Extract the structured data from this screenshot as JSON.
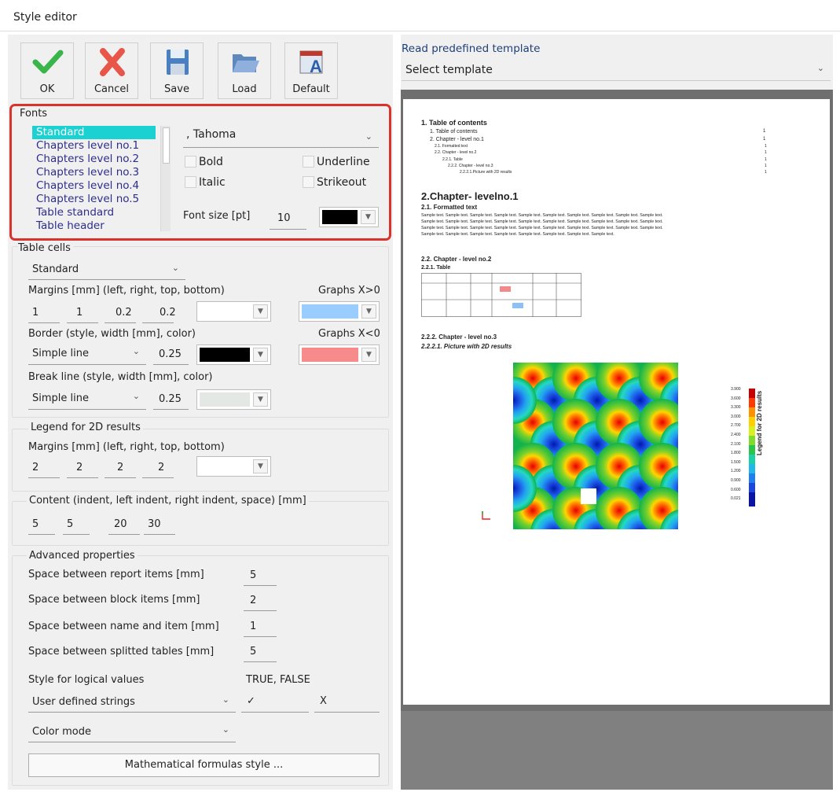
{
  "window": {
    "title": "Style editor"
  },
  "toolbar": {
    "ok": "OK",
    "cancel": "Cancel",
    "save": "Save",
    "load": "Load",
    "default": "Default"
  },
  "fonts": {
    "title": "Fonts",
    "items": [
      "Standard",
      "Chapters level no.1",
      "Chapters level no.2",
      "Chapters level no.3",
      "Chapters level no.4",
      "Chapters level no.5",
      "Table standard",
      "Table header"
    ],
    "font_name": ", Tahoma",
    "bold": "Bold",
    "underline": "Underline",
    "italic": "Italic",
    "strikeout": "Strikeout",
    "size_label": "Font size [pt]",
    "size_value": "10",
    "color": "#000000"
  },
  "table_cells": {
    "title": "Table cells",
    "style_select": "Standard",
    "margins_label": "Margins [mm] (left, right, top, bottom)",
    "margins": [
      "1",
      "1",
      "0.2",
      "0.2"
    ],
    "margins_color": "#ffffff",
    "graphs_pos_label": "Graphs X>0",
    "graphs_pos_color": "#99ccff",
    "border_label": "Border (style, width [mm], color)",
    "border_style": "Simple line",
    "border_width": "0.25",
    "border_color": "#000000",
    "graphs_neg_label": "Graphs X<0",
    "graphs_neg_color": "#f78a8a",
    "break_label": "Break line (style, width [mm], color)",
    "break_style": "Simple line",
    "break_width": "0.25",
    "break_color": "#e4e8e4"
  },
  "legend2d": {
    "title": "Legend for 2D results",
    "margins_label": "Margins [mm] (left, right, top, bottom)",
    "margins": [
      "2",
      "2",
      "2",
      "2"
    ],
    "color": "#ffffff"
  },
  "content": {
    "title": "Content (indent, left indent, right indent, space) [mm]",
    "values": [
      "5",
      "5",
      "20",
      "30"
    ]
  },
  "advanced": {
    "title": "Advanced properties",
    "rows": [
      {
        "label": "Space between report items [mm]",
        "value": "5"
      },
      {
        "label": "Space between block items [mm]",
        "value": "2"
      },
      {
        "label": "Space between name and item [mm]",
        "value": "1"
      },
      {
        "label": "Space between splitted tables [mm]",
        "value": "5"
      }
    ],
    "logical_label": "Style for logical values",
    "logical_hint": "TRUE, FALSE",
    "logical_select": "User defined strings",
    "true_str": "✓",
    "false_str": "X",
    "color_mode": "Color mode"
  },
  "math_button": "Mathematical formulas style ...",
  "template": {
    "label": "Read predefined template",
    "select": "Select template"
  },
  "preview": {
    "toc_title": "1. Table  of contents",
    "toc": [
      "1. Table of contents",
      "2. Chapter - level no.1",
      "2.1. Formatted text",
      "2.2. Chapter - level no.2",
      "2.2.1. Table",
      "2.2.2. Chapter - level no.3",
      "2.2.2.1.Picture with 2D results"
    ],
    "toc_pages": [
      "1",
      "1",
      "1",
      "1",
      "1",
      "1",
      "1"
    ],
    "chapter1": "2.Chapter- levelno.1",
    "formatted": "2.1.  Formatted   text",
    "sample_line1": "Sample text. Sample text. Sample text. Sample text. Sample text. Sample text. Sample text. Sample text. Sample text. Sample text.",
    "sample_line2": "Sample text. Sample text. Sample text. Sample text. Sample text. Sample text. Sample text. Sample text. Sample text. Sample text.",
    "sample_line3": "Sample text. Sample text. Sample text. Sample text. Sample text. Sample text. Sample text. Sample text. Sample text. Sample text.",
    "sample_line4": "Sample text. Sample text. Sample text. Sample text. Sample text. Sample text. Sample text. Sample text.",
    "chapter2": "2.2.  Chapter   -  level  no.2",
    "table_title": "2.2.1.  Table",
    "chapter3": "2.2.2.  Chapter  -  level  no.3",
    "picture_title": "2.2.2.1.  Picture with 2D results",
    "legend_title": "Legend for 2D results",
    "legend_values": [
      "3.900",
      "3.600",
      "3.300",
      "3.000",
      "2.700",
      "2.400",
      "2.100",
      "1.800",
      "1.500",
      "1.200",
      "0.900",
      "0.600",
      "0.021"
    ]
  }
}
